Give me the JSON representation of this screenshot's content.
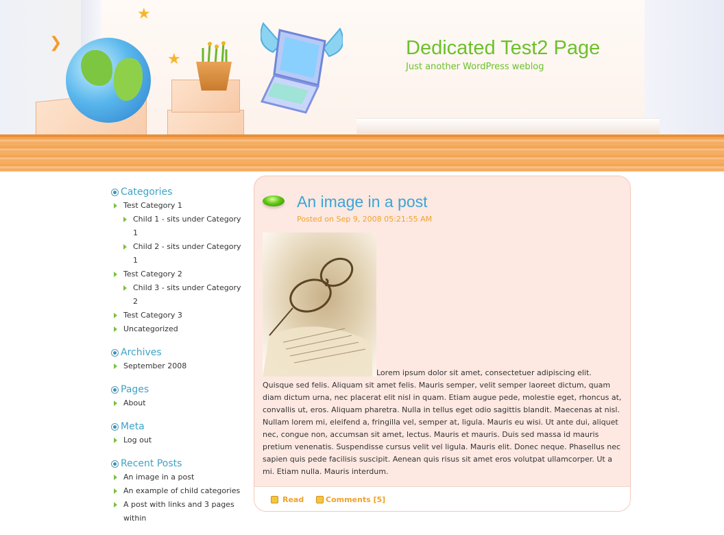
{
  "header": {
    "site_title": "Dedicated Test2 Page",
    "tagline": "Just another WordPress weblog"
  },
  "sidebar": {
    "categories": {
      "title": "Categories",
      "items": [
        {
          "label": "Test Category 1",
          "level": 0
        },
        {
          "label": "Child 1 - sits under Category 1",
          "level": 1
        },
        {
          "label": "Child 2 - sits under Category 1",
          "level": 1
        },
        {
          "label": "Test Category 2",
          "level": 0
        },
        {
          "label": "Child 3 - sits under Category 2",
          "level": 1
        },
        {
          "label": "Test Category 3",
          "level": 0
        },
        {
          "label": "Uncategorized",
          "level": 0
        }
      ]
    },
    "archives": {
      "title": "Archives",
      "items": [
        "September 2008"
      ]
    },
    "pages": {
      "title": "Pages",
      "items": [
        "About"
      ]
    },
    "meta": {
      "title": "Meta",
      "items": [
        "Log out"
      ]
    },
    "recent_posts": {
      "title": "Recent Posts",
      "items": [
        "An image in a post",
        "An example of child categories",
        "A post with links and 3 pages within"
      ]
    }
  },
  "post": {
    "title": "An image in a post",
    "meta": "Posted on Sep 9, 2008 05:21:55 AM",
    "body": "Lorem ipsum dolor sit amet, consectetuer adipiscing elit. Quisque sed felis. Aliquam sit amet felis. Mauris semper, velit semper laoreet dictum, quam diam dictum urna, nec placerat elit nisl in quam. Etiam augue pede, molestie eget, rhoncus at, convallis ut, eros. Aliquam pharetra. Nulla in tellus eget odio sagittis blandit. Maecenas at nisl. Nullam lorem mi, eleifend a, fringilla vel, semper at, ligula. Mauris eu wisi. Ut ante dui, aliquet nec, congue non, accumsan sit amet, lectus. Mauris et mauris. Duis sed massa id mauris pretium venenatis. Suspendisse cursus velit vel ligula. Mauris elit. Donec neque. Phasellus nec sapien quis pede facilisis suscipit. Aenean quis risus sit amet eros volutpat ullamcorper. Ut a mi. Etiam nulla. Mauris interdum.",
    "read_label": "Read",
    "comments_label": "Comments [5]"
  },
  "colors": {
    "title_green": "#6cc02a",
    "widget_blue": "#3ea3c6",
    "post_title_blue": "#3ba5d6",
    "meta_orange": "#f0a229",
    "post_bg": "#fde8e2"
  }
}
